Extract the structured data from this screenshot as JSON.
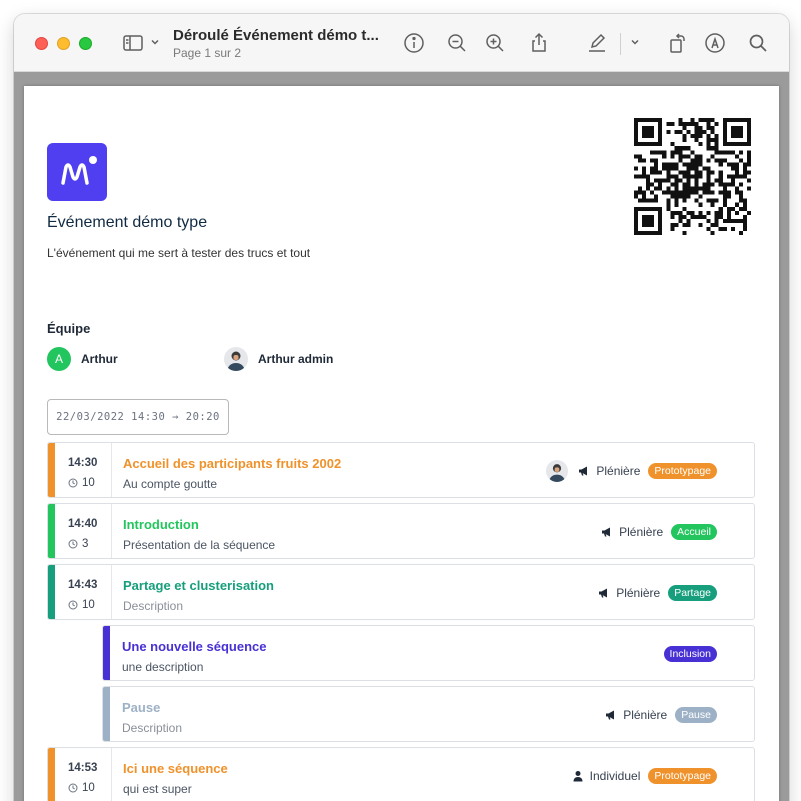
{
  "window": {
    "title": "Déroulé Événement démo t...",
    "subtitle": "Page 1 sur 2"
  },
  "toolbar_icons": [
    "sidebar-icon",
    "chevron-down-icon",
    "info-icon",
    "zoom-out-icon",
    "zoom-in-icon",
    "share-icon",
    "highlight-icon",
    "chevron-down-icon",
    "rotate-icon",
    "markup-icon",
    "search-icon"
  ],
  "event": {
    "title": "Événement démo type",
    "description": "L'événement qui me sert à tester des trucs et tout"
  },
  "team": {
    "heading": "Équipe",
    "members": [
      {
        "initial": "A",
        "name": "Arthur"
      },
      {
        "name": "Arthur admin"
      }
    ]
  },
  "date_range": "22/03/2022 14:30 → 20:20",
  "sessions": [
    {
      "time": "14:30",
      "duration": "10",
      "title": "Accueil des participants fruits 2002",
      "description": "Au compte goutte",
      "format": "Plénière",
      "tag": "Prototypage",
      "color": "#f0922b",
      "tag_color": "#f0922b",
      "title_color": "#f0922b",
      "desc_color": "#4b5563"
    },
    {
      "time": "14:40",
      "duration": "3",
      "title": "Introduction",
      "description": "Présentation de la séquence",
      "format": "Plénière",
      "tag": "Accueil",
      "color": "#22c55e",
      "tag_color": "#22c55e",
      "title_color": "#22c55e",
      "desc_color": "#4b5563"
    },
    {
      "time": "14:43",
      "duration": "10",
      "title": "Partage et clusterisation",
      "description": "Description",
      "format": "Plénière",
      "tag": "Partage",
      "color": "#179e7c",
      "tag_color": "#179e7c",
      "title_color": "#179e7c",
      "desc_color": "#8a8f98"
    },
    {
      "title": "Une nouvelle séquence",
      "description": "une description",
      "tag": "Inclusion",
      "color": "#4831d4",
      "tag_color": "#4831d4",
      "title_color": "#4831d4",
      "desc_color": "#4b5563"
    },
    {
      "title": "Pause",
      "description": "Description",
      "format": "Plénière",
      "tag": "Pause",
      "color": "#9db1c6",
      "tag_color": "#9db1c6",
      "title_color": "#9db1c6",
      "desc_color": "#8a8f98"
    },
    {
      "time": "14:53",
      "duration": "10",
      "title": "Ici une séquence",
      "description": "qui est super",
      "format": "Individuel",
      "tag": "Prototypage",
      "color": "#f0922b",
      "tag_color": "#f0922b",
      "title_color": "#f0922b",
      "desc_color": "#4b5563"
    }
  ]
}
